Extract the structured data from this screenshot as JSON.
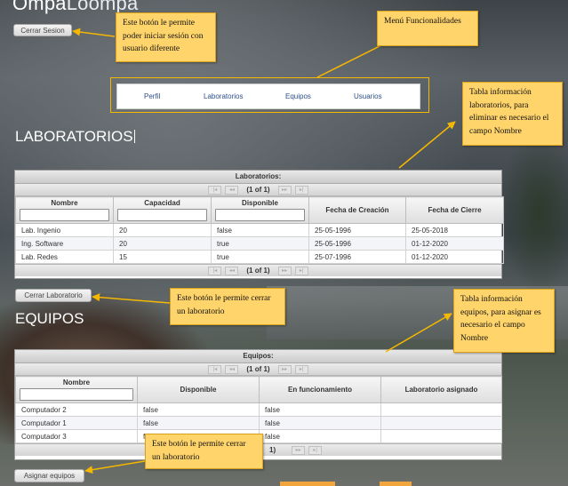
{
  "app": {
    "title_bold": "Ompa",
    "title_light": "Loompa"
  },
  "buttons": {
    "logout": "Cerrar Sesion",
    "close_lab": "Cerrar Laboratorio",
    "assign_equipment": "Asignar equipos"
  },
  "nav": {
    "items": [
      "Perfil",
      "Laboratorios",
      "Equipos",
      "Usuarios"
    ]
  },
  "sections": {
    "labs_title": "LABORATORIOS",
    "equipment_title": "EQUIPOS"
  },
  "labs_table": {
    "caption": "Laboratorios:",
    "page_status": "(1 of 1)",
    "columns": [
      "Nombre",
      "Capacidad",
      "Disponible",
      "Fecha de Creación",
      "Fecha de Cierre"
    ],
    "rows": [
      [
        "Lab. Ingenio",
        "20",
        "false",
        "25-05-1996",
        "25-05-2018"
      ],
      [
        "Ing. Software",
        "20",
        "true",
        "25-05-1996",
        "01-12-2020"
      ],
      [
        "Lab. Redes",
        "15",
        "true",
        "25-07-1996",
        "01-12-2020"
      ]
    ]
  },
  "equipment_table": {
    "caption": "Equipos:",
    "page_status": "(1 of 1)",
    "columns": [
      "Nombre",
      "Disponible",
      "En funcionamiento",
      "Laboratorio asignado"
    ],
    "rows": [
      [
        "Computador 2",
        "false",
        "false",
        ""
      ],
      [
        "Computador 1",
        "false",
        "false",
        ""
      ],
      [
        "Computador 3",
        "false",
        "false",
        ""
      ]
    ],
    "bottom_page_status_visible": "1)"
  },
  "annotations": {
    "logout_note": "Este botón le permite poder iniciar sesión con usuario diferente",
    "menu_note": "Menú Funcionalidades",
    "labs_table_note": "Tabla información laboratorios, para eliminar es necesario el campo Nombre",
    "close_lab_note": "Este botón le permite cerrar un laboratorio",
    "equipment_table_note": "Tabla información equipos, para asignar es necesario el campo Nombre",
    "assign_note": "Este botón le permite cerrar un laboratorio"
  },
  "colors": {
    "annotation_fill": "#ffd46b",
    "annotation_border": "#d9a21a",
    "arrow": "#f5b800",
    "nav_link": "#2b4f8c"
  }
}
